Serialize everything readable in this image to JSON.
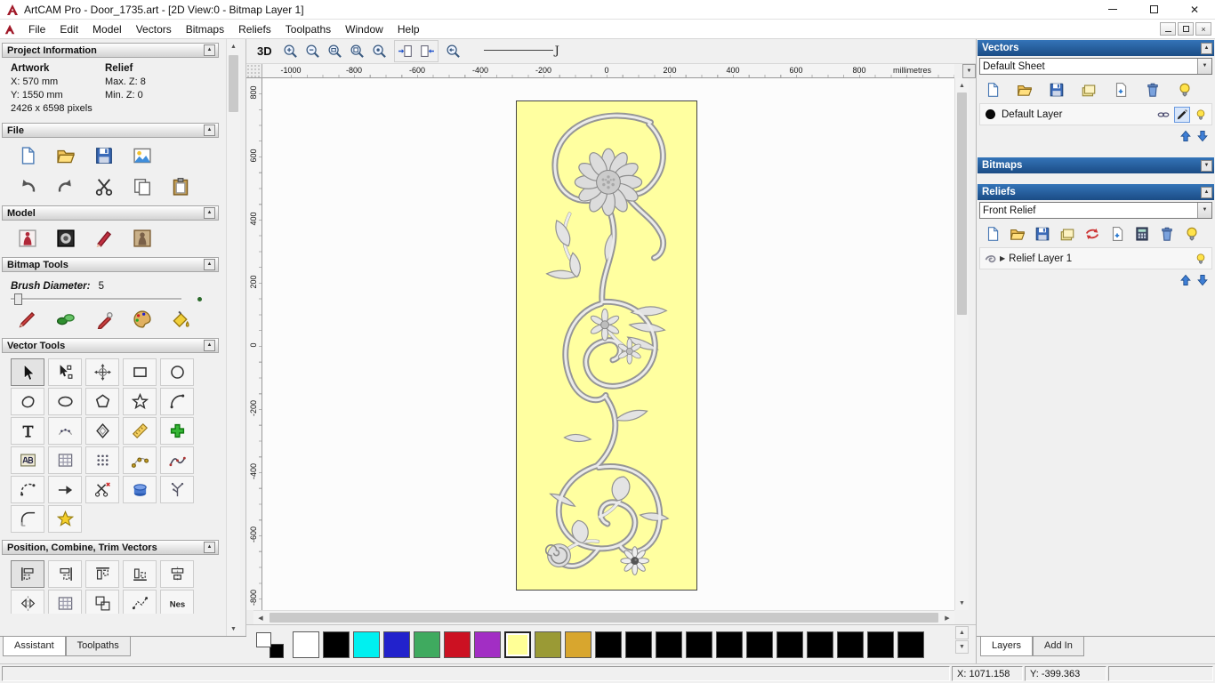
{
  "titlebar": {
    "title": "ArtCAM Pro - Door_1735.art - [2D View:0 - Bitmap Layer 1]"
  },
  "menu": {
    "items": [
      "File",
      "Edit",
      "Model",
      "Vectors",
      "Bitmaps",
      "Reliefs",
      "Toolpaths",
      "Window",
      "Help"
    ]
  },
  "left_panel": {
    "project_information": {
      "title": "Project Information",
      "artwork_label": "Artwork",
      "relief_label": "Relief",
      "x": "X: 570 mm",
      "y": "Y: 1550 mm",
      "max_z": "Max. Z: 8",
      "min_z": "Min. Z: 0",
      "pixels": "2426 x 6598 pixels"
    },
    "file_section": {
      "title": "File",
      "icons_row1": [
        "new-model",
        "open-file",
        "save-model",
        "import-image"
      ],
      "icons_row2": [
        "undo",
        "redo",
        "cut",
        "copy",
        "paste"
      ]
    },
    "model_section": {
      "title": "Model",
      "icons": [
        "model-wizard",
        "adjust-image",
        "sculpt-tool",
        "photo-relief"
      ]
    },
    "bitmap_tools": {
      "title": "Bitmap Tools",
      "brush_diameter_label": "Brush Diameter:",
      "brush_diameter_value": "5",
      "icons": [
        "paint-brush",
        "colour-picker",
        "paint-selective",
        "colour-palette",
        "flood-fill"
      ]
    },
    "vector_tools": {
      "title": "Vector Tools",
      "icons": [
        "select-vectors",
        "node-editing",
        "transform-vectors",
        "create-rectangle",
        "create-circle",
        "create-polyline",
        "create-ellipse",
        "create-polygon",
        "create-star",
        "create-arc",
        "create-text",
        "text-on-curve",
        "offset-vector",
        "measure-tool",
        "paste-relief",
        "text-block",
        "block-copy",
        "block-rotate",
        "paste-along-curve",
        "fit-polyline",
        "join-vectors",
        "trim-vector",
        "cut-vector",
        "extrude-tool",
        "fit-arcs",
        "fillet-tool",
        "vector-doctor"
      ]
    },
    "position_section": {
      "title": "Position, Combine, Trim Vectors",
      "icons": [
        "align-left",
        "align-right",
        "align-top",
        "align-bottom",
        "align-centre",
        "mirror-vectors",
        "block-array",
        "group-vectors",
        "join-with-line",
        "nest-vectors"
      ]
    },
    "nest_label": "Nes",
    "tabs": [
      "Assistant",
      "Toolpaths"
    ]
  },
  "canvas": {
    "toolbar": {
      "view_3d_label": "3D",
      "zoom_icons": [
        "zoom-in",
        "zoom-out",
        "zoom-box",
        "zoom-fit",
        "zoom-object"
      ],
      "nav_icons": [
        "snap-view-left",
        "snap-view-right"
      ],
      "history_icons": [
        "zoom-previous"
      ],
      "spline_label": "J"
    },
    "h_ruler": {
      "labels": [
        "-1000",
        "-800",
        "-600",
        "-400",
        "-200",
        "0",
        "200",
        "400",
        "600",
        "800"
      ],
      "unit": "millimetres"
    },
    "v_ruler": {
      "labels": [
        "800",
        "600",
        "400",
        "200",
        "0",
        "-200",
        "-400",
        "-600",
        "-800"
      ]
    },
    "palette": {
      "colors": [
        "#ffffff",
        "#000000",
        "#00f0f0",
        "#2222cc",
        "#3faa5f",
        "#cc1122",
        "#a22ec4",
        "#ffff96",
        "#9a9a35",
        "#d8a62e",
        "#000000",
        "#000000",
        "#000000",
        "#000000",
        "#000000",
        "#000000",
        "#000000",
        "#000000",
        "#000000",
        "#000000",
        "#000000"
      ],
      "selected_index": 7
    }
  },
  "right_panel": {
    "vectors": {
      "title": "Vectors",
      "sheet_value": "Default Sheet",
      "toolbar": [
        "new-vector-layer",
        "open-vector-layer",
        "save-vector-layer",
        "sheet-stack",
        "new-sheet",
        "delete-layer",
        "show-all-layers"
      ],
      "layer_name": "Default Layer",
      "layer_icons": [
        "layer-link",
        "layer-edit",
        "layer-visibility"
      ],
      "arrows": [
        "move-layer-up",
        "move-layer-down"
      ]
    },
    "bitmaps": {
      "title": "Bitmaps"
    },
    "reliefs": {
      "title": "Reliefs",
      "relief_value": "Front Relief",
      "toolbar": [
        "new-relief-layer",
        "open-relief-layer",
        "save-relief-layer",
        "relief-stack",
        "transfer-relief",
        "blank-relief",
        "calculate-relief",
        "delete-relief-layer",
        "show-relief-layers"
      ],
      "layer_name": "Relief Layer 1",
      "layer_thumb": [
        "relief-thumbnail"
      ],
      "layer_icons": [
        "layer-visibility"
      ],
      "arrows": [
        "move-layer-up",
        "move-layer-down"
      ]
    },
    "tabs": [
      "Layers",
      "Add In"
    ]
  },
  "status_bar": {
    "x": "X: 1071.158",
    "y": "Y: -399.363"
  }
}
